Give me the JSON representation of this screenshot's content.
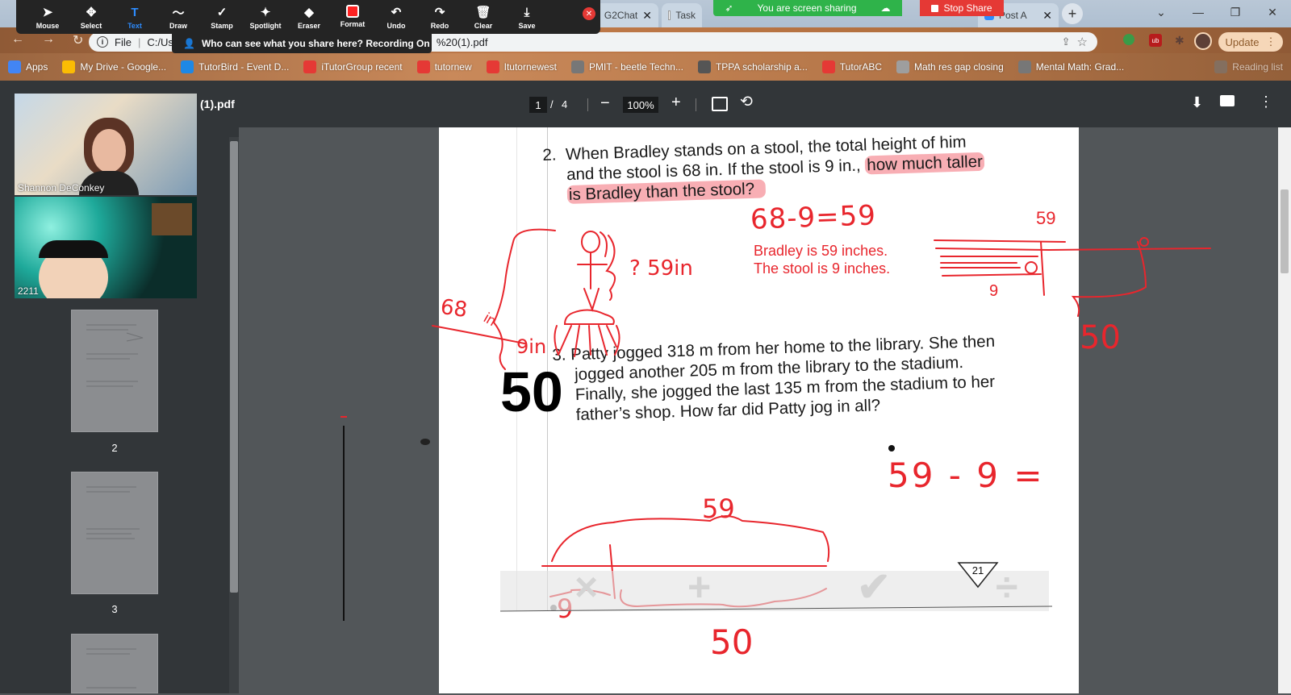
{
  "zoom_toolbar": {
    "tools": [
      {
        "label": "Mouse",
        "icon": "cursor-icon"
      },
      {
        "label": "Select",
        "icon": "move-icon"
      },
      {
        "label": "Text",
        "icon": "text-icon"
      },
      {
        "label": "Draw",
        "icon": "draw-icon"
      },
      {
        "label": "Stamp",
        "icon": "check-icon"
      },
      {
        "label": "Spotlight",
        "icon": "spotlight-icon"
      },
      {
        "label": "Eraser",
        "icon": "eraser-icon"
      },
      {
        "label": "Format",
        "icon": "format-icon"
      },
      {
        "label": "Undo",
        "icon": "undo-icon"
      },
      {
        "label": "Redo",
        "icon": "redo-icon"
      },
      {
        "label": "Clear",
        "icon": "trash-icon"
      },
      {
        "label": "Save",
        "icon": "save-icon"
      }
    ],
    "active_tool": "Text",
    "recording_tip": "Who can see what you share here? Recording On"
  },
  "share": {
    "status": "You are screen sharing",
    "stop_label": "Stop Share"
  },
  "tabs": [
    {
      "label": "G2Chat"
    },
    {
      "label": "Task"
    },
    {
      "label": "Post A"
    }
  ],
  "address": {
    "file_label": "File",
    "url_prefix": "C:/Us",
    "url_suffix": "%20(1).pdf",
    "update_label": "Update"
  },
  "bookmarks": [
    {
      "label": "Apps",
      "color": "#4285f4"
    },
    {
      "label": "My Drive - Google...",
      "color": "#fbbc04"
    },
    {
      "label": "TutorBird - Event D...",
      "color": "#1e88e5"
    },
    {
      "label": "iTutorGroup recent",
      "color": "#e53935"
    },
    {
      "label": "tutornew",
      "color": "#e53935"
    },
    {
      "label": "Itutornewest",
      "color": "#e53935"
    },
    {
      "label": "PMIT - beetle Techn...",
      "color": "#777777"
    },
    {
      "label": "TPPA scholarship a...",
      "color": "#555555"
    },
    {
      "label": "TutorABC",
      "color": "#e53935"
    },
    {
      "label": "Math res gap closing",
      "color": "#9e9e9e"
    },
    {
      "label": "Mental Math: Grad...",
      "color": "#777777"
    },
    {
      "label": "Reading list",
      "color": "#777777"
    }
  ],
  "pdf": {
    "filename": "(1).pdf",
    "page_current": "1",
    "page_sep": "/",
    "page_total": "4",
    "zoom": "100%",
    "thumb_labels": [
      "2",
      "3"
    ]
  },
  "participants": [
    {
      "name": "Shannon DeConkey"
    },
    {
      "name": "2211"
    }
  ],
  "problem2": {
    "number": "2.",
    "line1": "When Bradley stands on a stool, the total height of him",
    "line2a": "and the stool is 68 in. If the stool is 9 in.,",
    "line2b": "how much taller",
    "line3": "is Bradley than the stool?"
  },
  "problem3": {
    "number": "3.",
    "line1": "Patty jogged 318 m from her home to the library. She then",
    "line2": "jogged another 205 m from the library to the stadium.",
    "line3": "Finally, she jogged the last 135 m from the stadium to her",
    "line4": "father’s shop. How far did Patty jog in all?"
  },
  "annotations": {
    "equation": "68-9=59",
    "answer_line1": "Bradley is 59 inches.",
    "answer_line2": "The stool is 9 inches.",
    "q59": "? 59in",
    "in68": "68",
    "in68b": "in",
    "in9": "9in",
    "big50": "50",
    "top59": "59",
    "right9": "9",
    "right50": "50",
    "expr": "59 - 9 =",
    "bar59": "59",
    "bar9": "9",
    "bar50": "50"
  },
  "page_number": "21"
}
